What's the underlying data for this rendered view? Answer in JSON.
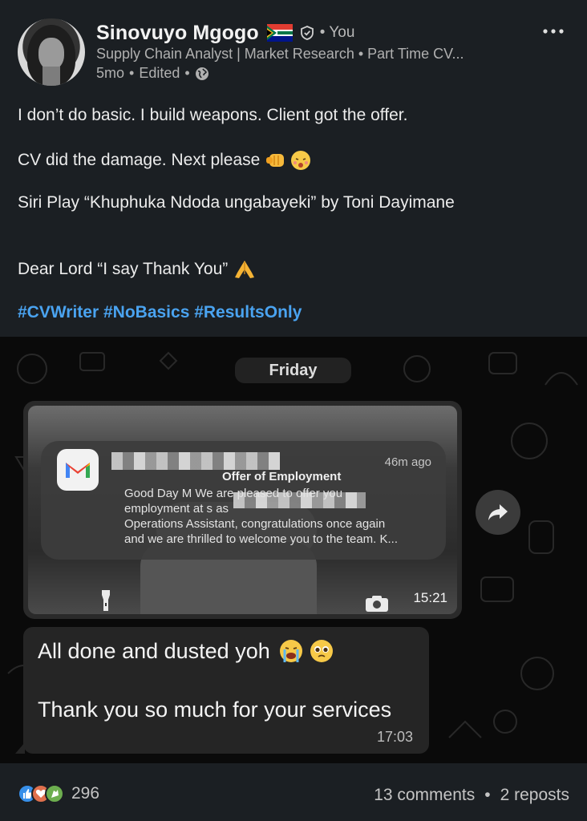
{
  "author": {
    "name": "Sinovuyo Mgogo",
    "relation": "You",
    "headline": "Supply Chain Analyst | Market Research • Part Time CV...",
    "time": "5mo",
    "edited": "Edited"
  },
  "post": {
    "line1": "I don’t do basic. I build weapons. Client got the offer.",
    "line2": "CV did the damage. Next please",
    "line3": "Siri Play “Khuphuka Ndoda ungabayeki” by Toni Dayimane",
    "line4": "Dear Lord “I say Thank You”",
    "hashtags": "#CVWriter #NoBasics #ResultsOnly"
  },
  "chat": {
    "day": "Friday",
    "notification": {
      "time": "46m ago",
      "title": "Offer of Employment",
      "line1": "Good Day M          We are pleased to offer you",
      "line2": "employment at                                       s as",
      "line3": "Operations Assistant, congratulations once again",
      "line4": "and we are thrilled to welcome you to the team. K..."
    },
    "photo_time": "15:21",
    "message_line1": "All done and dusted yoh",
    "message_line2": "Thank you so much for your services",
    "message_time": "17:03"
  },
  "footer": {
    "reaction_count": "296",
    "comments": "13 comments",
    "reposts": "2 reposts"
  },
  "icons": [
    "flag-south-africa-icon",
    "verified-shield-icon",
    "globe-icon",
    "more-icon",
    "fist-emoji-icon",
    "woozy-emoji-icon",
    "pray-emoji-icon",
    "gmail-icon",
    "flashlight-icon",
    "camera-icon",
    "forward-share-icon",
    "crying-emoji-icon",
    "pleading-emoji-icon",
    "like-reaction-icon",
    "love-reaction-icon",
    "celebrate-reaction-icon"
  ],
  "colors": {
    "background": "#1b1f23",
    "hashtag": "#4aa3f0",
    "like": "#378fe9",
    "love": "#df704d",
    "celebrate": "#6dae4f"
  }
}
